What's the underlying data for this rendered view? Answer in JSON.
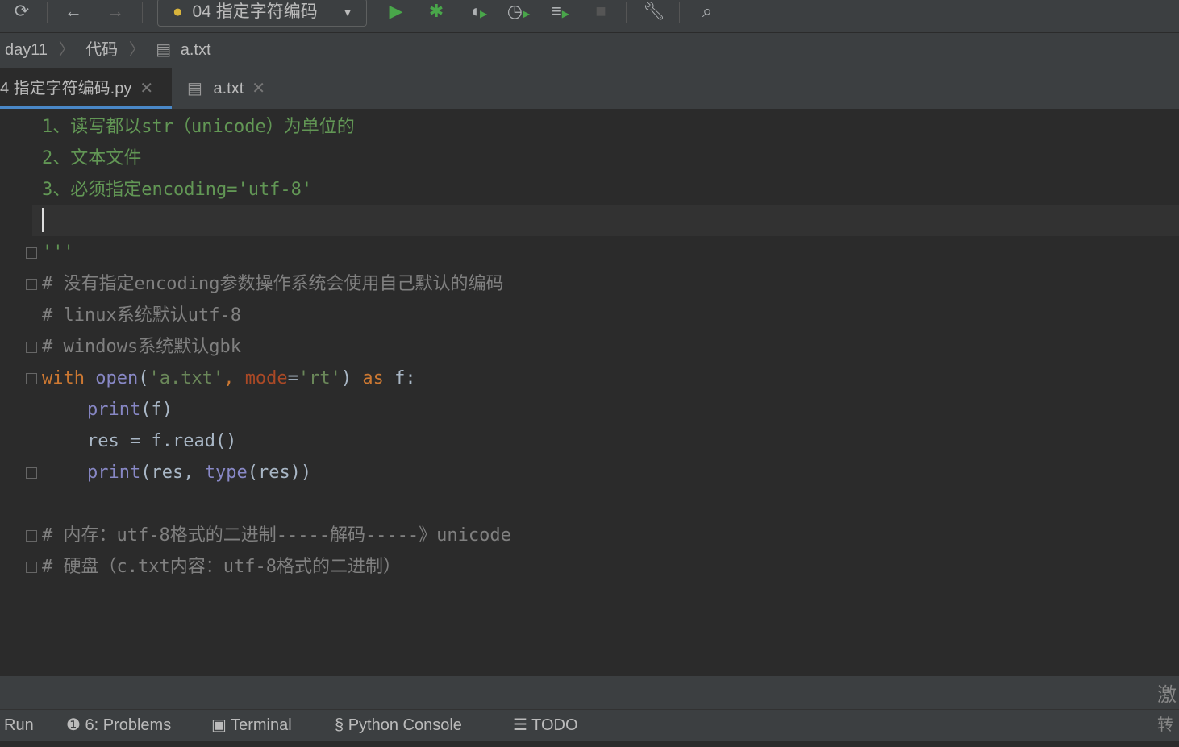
{
  "toolbar": {
    "run_config": "04 指定字符编码",
    "icons": [
      "refresh-icon",
      "back-icon",
      "forward-icon",
      "run-icon",
      "debug-icon",
      "coverage-icon",
      "profile-icon",
      "concurrency-icon",
      "stop-icon",
      "wrench-icon",
      "search-icon"
    ]
  },
  "breadcrumb": [
    "day11",
    "代码",
    "a.txt"
  ],
  "tabs": [
    {
      "label": "4 指定字符编码.py",
      "active": true
    },
    {
      "label": "a.txt",
      "active": false
    }
  ],
  "code": {
    "l1": "1、读写都以str（unicode）为单位的",
    "l2": "2、文本文件",
    "l3": "3、必须指定encoding='utf-8'",
    "l5": "'''",
    "l6": "# 没有指定encoding参数操作系统会使用自己默认的编码",
    "l7": "# linux系统默认utf-8",
    "l8": "# windows系统默认gbk",
    "l9": {
      "with": "with ",
      "open": "open",
      "p1": "(",
      "s1": "'a.txt'",
      "c1": ", ",
      "mode": "mode",
      "eq": "=",
      "s2": "'rt'",
      "p2": ") ",
      "as": "as",
      " f": " f:"
    },
    "l10": {
      "print": "print",
      "rest": "(f)"
    },
    "l11": "res = f.read()",
    "l12": {
      "print": "print",
      "a": "(res, ",
      "type": "type",
      "b": "(res))"
    },
    "l14": "# 内存：utf-8格式的二进制-----解码-----》unicode",
    "l15": "# 硬盘（c.txt内容：utf-8格式的二进制）"
  },
  "bottom": {
    "run": "Run",
    "problems": "6: Problems",
    "terminal": "Terminal",
    "python_console": "Python Console",
    "todo": "TODO"
  },
  "watermark": [
    "激",
    "转"
  ],
  "colors": {
    "accent": "#4a88c7",
    "keyword": "#cc7832",
    "string": "#6a8759",
    "builtin": "#8888c6",
    "comment": "#808080",
    "docstring": "#629755"
  }
}
